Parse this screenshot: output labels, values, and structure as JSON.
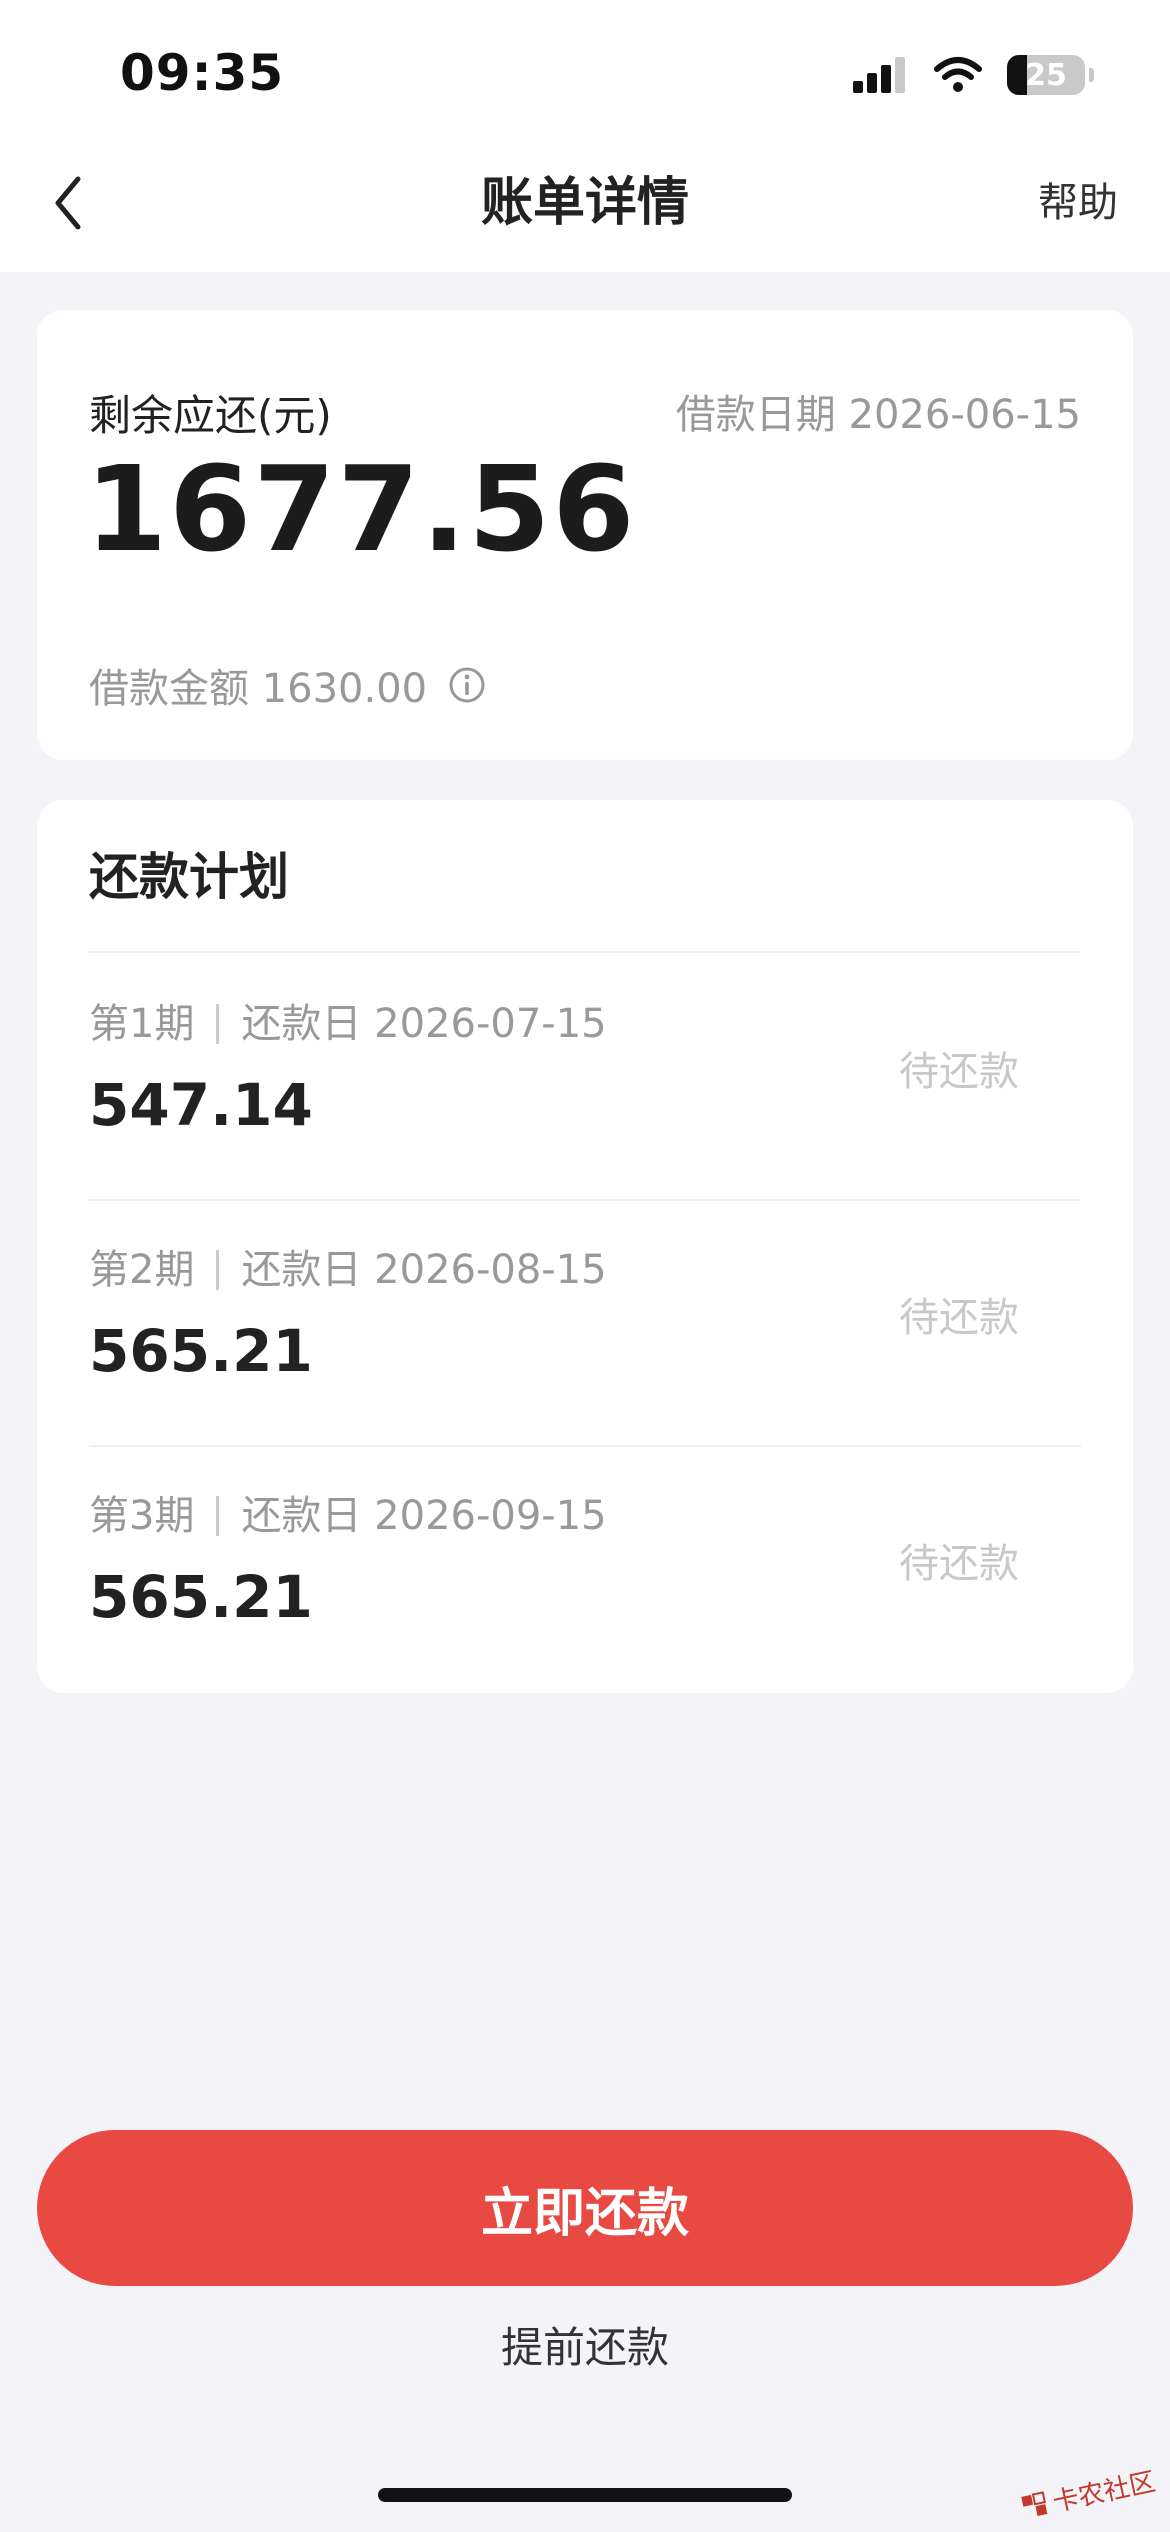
{
  "status_bar": {
    "time": "09:35",
    "battery_level": "25",
    "battery_fraction": 0.25
  },
  "nav": {
    "title": "账单详情",
    "help": "帮助",
    "back_icon": "chevron-left-icon"
  },
  "summary": {
    "remaining_label": "剩余应还(元)",
    "remaining_amount": "1677.56",
    "loan_date": "借款日期 2026-06-15",
    "loan_amount": "借款金额 1630.00",
    "info_icon": "info-icon"
  },
  "plan": {
    "title": "还款计划",
    "items": [
      {
        "period": "第1期",
        "due": "还款日 2026-07-15",
        "amount": "547.14",
        "status": "待还款"
      },
      {
        "period": "第2期",
        "due": "还款日 2026-08-15",
        "amount": "565.21",
        "status": "待还款"
      },
      {
        "period": "第3期",
        "due": "还款日 2026-09-15",
        "amount": "565.21",
        "status": "待还款"
      }
    ]
  },
  "actions": {
    "pay_now": "立即还款",
    "prepay": "提前还款"
  },
  "watermark": {
    "text": "卡农社区"
  },
  "colors": {
    "accent": "#e84a43",
    "background": "#f4f4f8",
    "muted_text": "#999999"
  }
}
